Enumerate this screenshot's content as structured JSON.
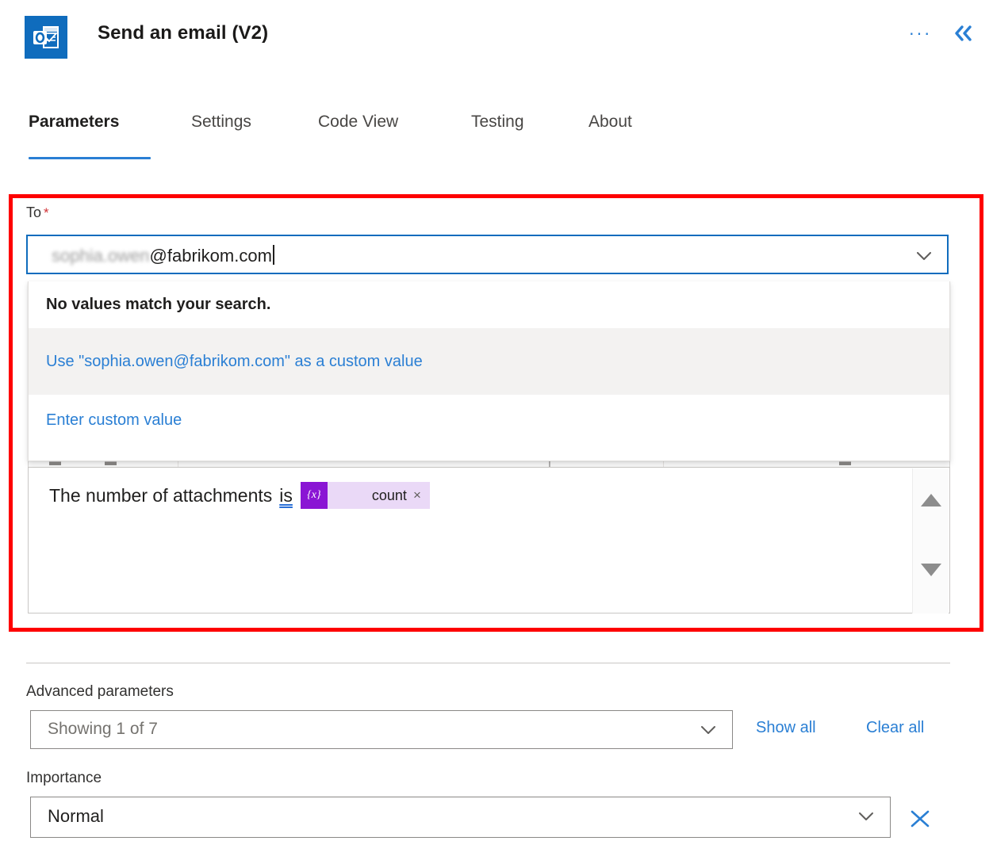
{
  "header": {
    "icon_name": "outlook-icon",
    "title": "Send an email (V2)",
    "ellipsis": "···",
    "collapse_icon": "double-chevron-left-icon"
  },
  "tabs": [
    {
      "label": "Parameters",
      "active": true
    },
    {
      "label": "Settings",
      "active": false
    },
    {
      "label": "Code View",
      "active": false
    },
    {
      "label": "Testing",
      "active": false
    },
    {
      "label": "About",
      "active": false
    }
  ],
  "to_field": {
    "label": "To",
    "required_marker": "*",
    "value_redacted": "sophia.owen",
    "value_visible": "@fabrikom.com",
    "full_value": "sophia.owen@fabrikom.com",
    "chevron_icon": "chevron-down-icon"
  },
  "dropdown": {
    "no_match": "No values match your search.",
    "custom_value": "Use \"sophia.owen@fabrikom.com\" as a custom value",
    "enter_custom": "Enter custom value"
  },
  "body": {
    "text_prefix": "The number of attachments",
    "spellchecked_word": "is",
    "token_icon": "{x}",
    "token_label": "count",
    "token_remove": "×",
    "scroll_up_icon": "scroll-up-arrow-icon",
    "scroll_down_icon": "scroll-down-arrow-icon"
  },
  "advanced": {
    "label": "Advanced parameters",
    "showing_value": "Showing 1 of 7",
    "show_all": "Show all",
    "clear_all": "Clear all",
    "importance_label": "Importance",
    "importance_value": "Normal",
    "clear_icon": "close-x-icon"
  },
  "colors": {
    "accent": "#2a7fd4",
    "brand": "#0f6cbd",
    "annotation": "#fe0000",
    "token_purple": "#8a15d4",
    "token_bg": "#ead9f7",
    "required": "#d13438"
  }
}
